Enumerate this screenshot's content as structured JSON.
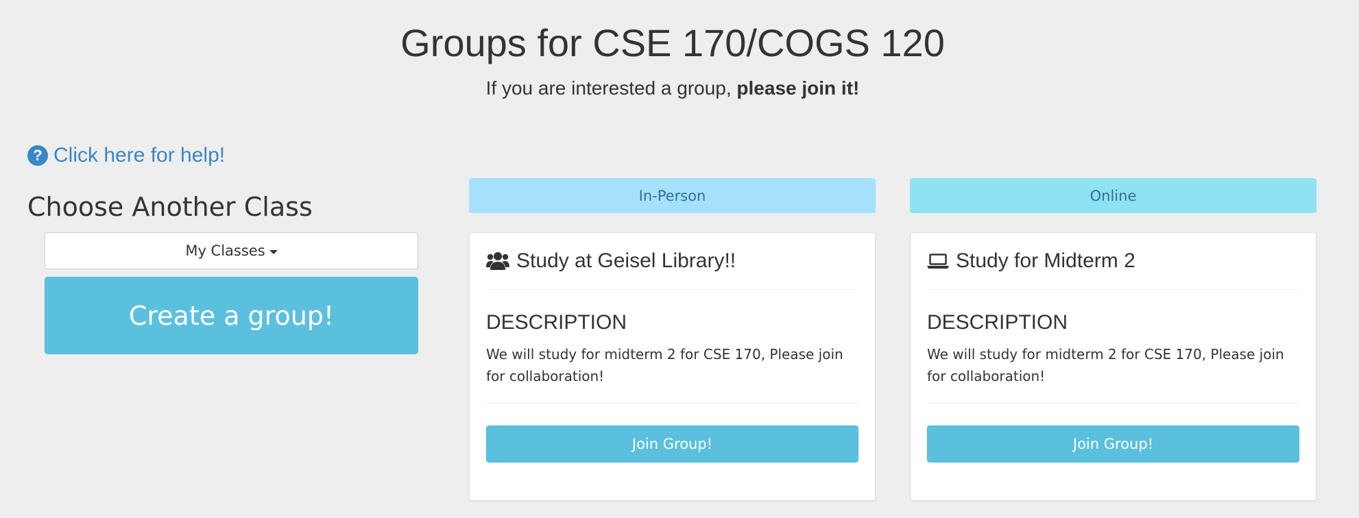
{
  "header": {
    "title": "Groups for CSE 170/COGS 120",
    "subtitle_prefix": "If you are interested a group, ",
    "subtitle_bold": "please join it!"
  },
  "help": {
    "icon": "question-circle-icon",
    "label": "Click here for help!",
    "color": "#3a86c6"
  },
  "sidebar": {
    "heading": "Choose Another Class",
    "classes_dropdown_label": "My Classes",
    "create_button_label": "Create a group!",
    "accent": "#5bc0de"
  },
  "groups": [
    {
      "type_label": "In-Person",
      "type_color": "#a6e1fc",
      "icon": "users-icon",
      "title": "Study at Geisel Library!!",
      "description_heading": "DESCRIPTION",
      "description": "We will study for midterm 2 for CSE 170, Please join for collaboration!",
      "join_label": "Join Group!"
    },
    {
      "type_label": "Online",
      "type_color": "#8ee2f2",
      "icon": "laptop-icon",
      "title": "Study for Midterm 2",
      "description_heading": "DESCRIPTION",
      "description": "We will study for midterm 2 for CSE 170, Please join for collaboration!",
      "join_label": "Join Group!"
    }
  ]
}
